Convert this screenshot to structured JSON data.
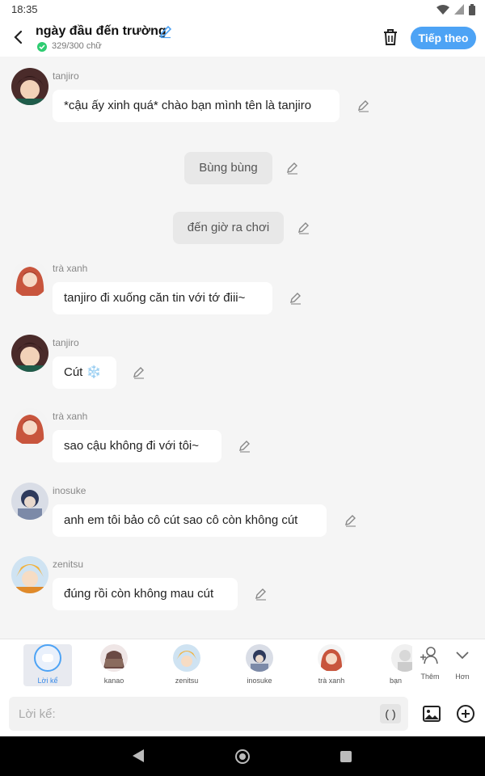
{
  "status_bar": {
    "time": "18:35"
  },
  "header": {
    "title": "ngày đầu đến trường",
    "char_count": "329/300 chữ",
    "next_label": "Tiếp theo"
  },
  "messages": [
    {
      "type": "character",
      "sender": "tanjiro",
      "text": "*cậu ấy xinh quá* chào bạn mình tên là tanjiro",
      "avatar": "tanjiro-avatar"
    },
    {
      "type": "narration",
      "text": "Bùng bùng"
    },
    {
      "type": "narration",
      "text": "đến giờ ra chơi"
    },
    {
      "type": "character",
      "sender": "trà xanh",
      "text": "tanjiro đi xuống căn tin với tớ điii~",
      "avatar": "tra-xanh-avatar"
    },
    {
      "type": "character",
      "sender": "tanjiro",
      "text": "Cút ❄️",
      "avatar": "tanjiro-avatar"
    },
    {
      "type": "character",
      "sender": "trà xanh",
      "text": "sao cậu không đi với tôi~",
      "avatar": "tra-xanh-avatar"
    },
    {
      "type": "character",
      "sender": "inosuke",
      "text": "anh em tôi bảo cô cút sao cô còn không cút",
      "avatar": "inosuke-avatar"
    },
    {
      "type": "character",
      "sender": "zenitsu",
      "text": "đúng rồi còn không mau cút",
      "avatar": "zenitsu-avatar"
    }
  ],
  "character_tray": {
    "items": [
      {
        "label": "Lời kể",
        "active": true
      },
      {
        "label": "kanao"
      },
      {
        "label": "zenitsu"
      },
      {
        "label": "inosuke"
      },
      {
        "label": "trà xanh"
      },
      {
        "label": "bạn"
      }
    ],
    "add_label": "Thêm",
    "more_label": "Hơn"
  },
  "composer": {
    "placeholder": "Lời kể:",
    "paren_label": "( )"
  },
  "colors": {
    "accent": "#4da3f5",
    "bubble": "#ffffff",
    "narration": "#e8e8e8",
    "background": "#f5f5f5"
  }
}
